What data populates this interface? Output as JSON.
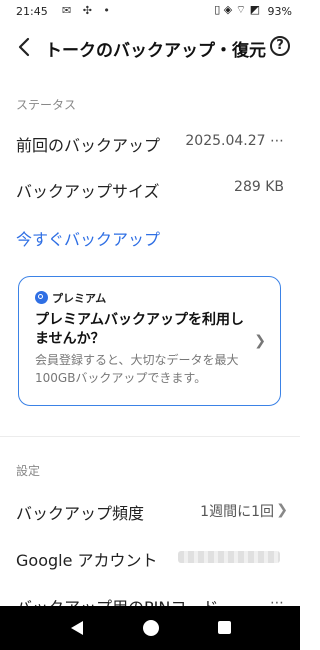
{
  "status_bar": {
    "time": "21:45",
    "left_icons": "✉ ✣ •",
    "signal_icons": "▯ ◈ ⌔ ◩",
    "battery": "93%"
  },
  "header": {
    "title": "トークのバックアップ・復元",
    "help_label": "?"
  },
  "status_section": {
    "label": "ステータス",
    "last_backup_label": "前回のバックアップ",
    "last_backup_value": "2025.04.27 ⋯",
    "backup_size_label": "バックアップサイズ",
    "backup_size_value": "289 KB",
    "backup_now_label": "今すぐバックアップ"
  },
  "promo": {
    "badge": "プレミアム",
    "title": "プレミアムバックアップを利用しませんか？",
    "description": "会員登録すると、大切なデータを最大100GBバックアップできます。"
  },
  "settings_section": {
    "label": "設定",
    "frequency_label": "バックアップ頻度",
    "frequency_value": "1週間に1回",
    "google_account_label": "Google アカウント",
    "pin_label": "バックアップ用のPINコード",
    "pin_value": "⋯"
  },
  "colors": {
    "accent": "#2f6fe4",
    "card_border": "#3b82e6",
    "nav_bar": "#000000"
  }
}
